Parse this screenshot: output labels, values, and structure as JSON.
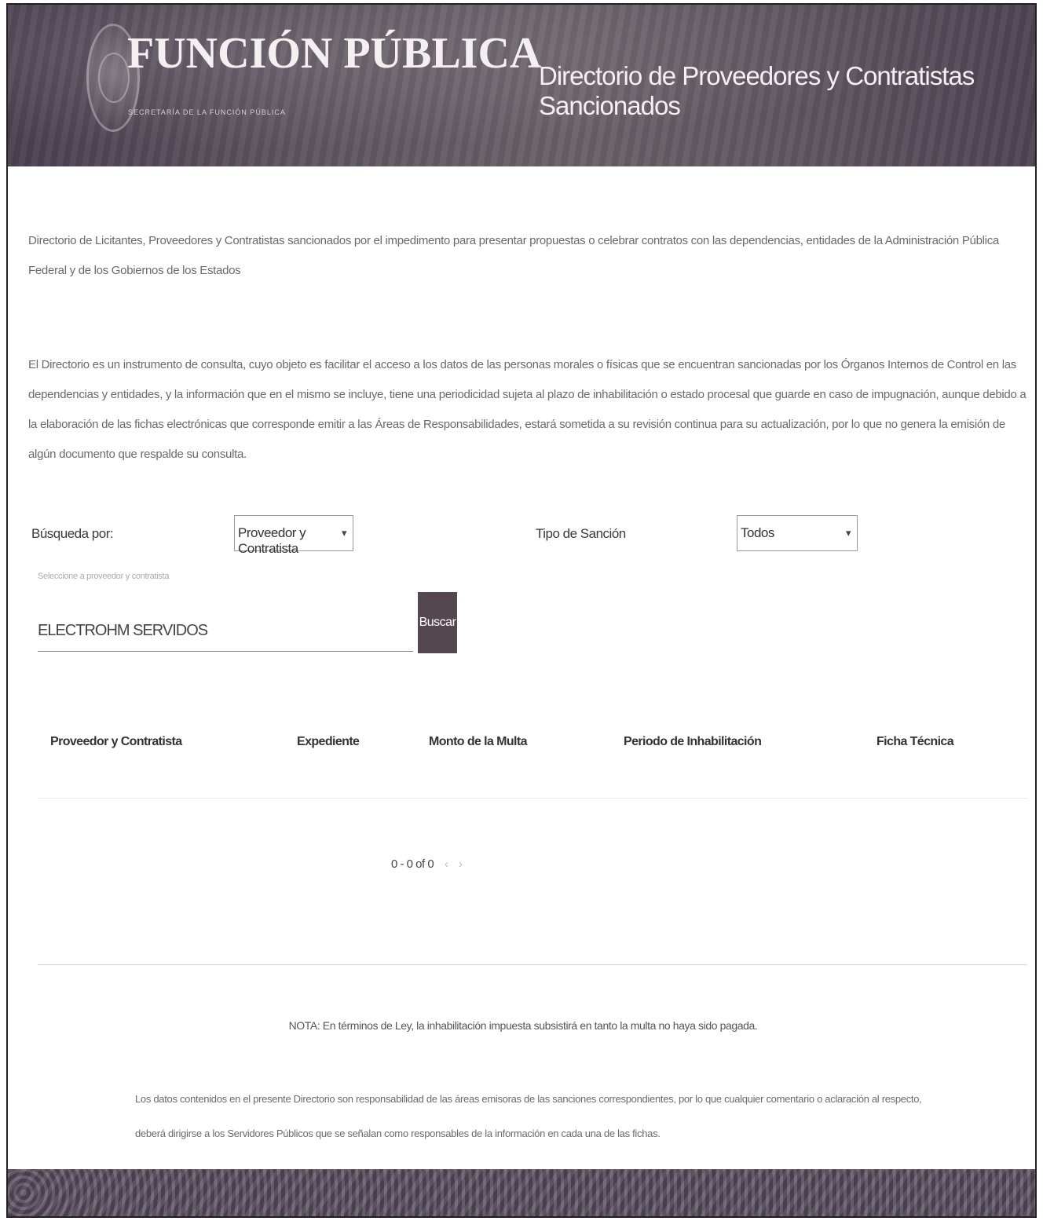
{
  "header": {
    "brand": "FUNCIÓN PÚBLICA",
    "brand_sub": "SECRETARÍA DE LA FUNCIÓN PÚBLICA",
    "title": "Directorio de Proveedores y Contratistas Sancionados"
  },
  "intro": {
    "p1": "Directorio de Licitantes, Proveedores y Contratistas sancionados por el impedimento para presentar propuestas o celebrar contratos con las dependencias, entidades de la Administración Pública Federal y de los Gobiernos de los Estados",
    "p2": "El Directorio es un instrumento de consulta, cuyo objeto es facilitar el acceso a los datos de las personas morales o físicas que se encuentran sancionadas por los Órganos Internos de Control en las dependencias y entidades, y la información que en el mismo se incluye, tiene una periodicidad sujeta al plazo de inhabilitación o estado procesal que guarde en caso de impugnación, aunque debido a la elaboración de las fichas electrónicas que corresponde emitir a las Áreas de Responsabilidades, estará sometida a su revisión continua para su actualización, por lo que no genera la emisión de algún documento que respalde su consulta."
  },
  "filters": {
    "busqueda_label": "Búsqueda por:",
    "busqueda_value": "Proveedor y Contratista",
    "tipo_label": "Tipo de Sanción",
    "tipo_value": "Todos",
    "hint": "Seleccione a proveedor y contratista",
    "search_value": "ELECTROHM SERVIDOS",
    "button_label": "Buscar"
  },
  "table": {
    "columns": [
      "Proveedor y Contratista",
      "Expediente",
      "Monto de la Multa",
      "Periodo de Inhabilitación",
      "Ficha Técnica"
    ],
    "pagination": "0 - 0 of 0",
    "prev": "‹",
    "next": "›"
  },
  "note": "NOTA: En términos de Ley, la inhabilitación impuesta subsistirá en tanto la multa no haya sido pagada.",
  "disclaimer": "Los datos contenidos en el presente Directorio son responsabilidad de las áreas emisoras de las sanciones correspondientes, por lo que cualquier comentario o aclaración al respecto, deberá dirigirse a los Servidores Públicos que se señalan como responsables de la información en cada una de las fichas."
}
